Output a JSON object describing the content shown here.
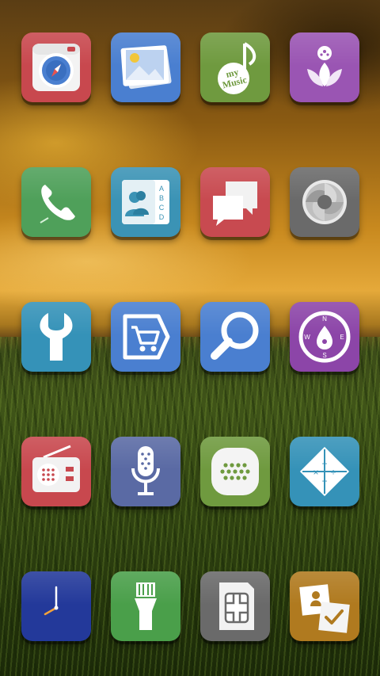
{
  "screen": "home-screen",
  "apps": [
    {
      "id": "camera",
      "icon": "camera-icon",
      "color": "#c8484e"
    },
    {
      "id": "gallery",
      "icon": "gallery-icon",
      "color": "#4a7fd0"
    },
    {
      "id": "music",
      "icon": "music-note-icon",
      "color": "#6f9a3f",
      "label": "my music"
    },
    {
      "id": "lotus",
      "icon": "lotus-icon",
      "color": "#9a55b3"
    },
    {
      "id": "phone",
      "icon": "phone-icon",
      "color": "#4fa05a"
    },
    {
      "id": "contacts",
      "icon": "contacts-icon",
      "color": "#3b93b5",
      "label": "A B C D"
    },
    {
      "id": "messages",
      "icon": "chat-bubbles-icon",
      "color": "#c84a50"
    },
    {
      "id": "aperture",
      "icon": "aperture-icon",
      "color": "#6a6a6a"
    },
    {
      "id": "settings",
      "icon": "wrench-icon",
      "color": "#3592b8"
    },
    {
      "id": "shop",
      "icon": "shopping-cart-icon",
      "color": "#4a7fd0"
    },
    {
      "id": "search",
      "icon": "magnifier-icon",
      "color": "#4a7fd0"
    },
    {
      "id": "compass",
      "icon": "compass-icon",
      "color": "#8c45a8",
      "label": "N W E S"
    },
    {
      "id": "radio",
      "icon": "radio-icon",
      "color": "#c8484e"
    },
    {
      "id": "voice",
      "icon": "microphone-icon",
      "color": "#5a6aa4"
    },
    {
      "id": "speaker",
      "icon": "speaker-grille-icon",
      "color": "#6f9a3f"
    },
    {
      "id": "calculator",
      "icon": "calculator-icon",
      "color": "#3592b8",
      "label": "+ − × ÷"
    },
    {
      "id": "clock",
      "icon": "clock-icon",
      "color": "#23399a"
    },
    {
      "id": "flashlight",
      "icon": "flashlight-icon",
      "color": "#4a9f4a"
    },
    {
      "id": "sim",
      "icon": "sim-card-icon",
      "color": "#6a6a6a"
    },
    {
      "id": "tasks",
      "icon": "notes-checkmark-icon",
      "color": "#b07a1f"
    }
  ]
}
